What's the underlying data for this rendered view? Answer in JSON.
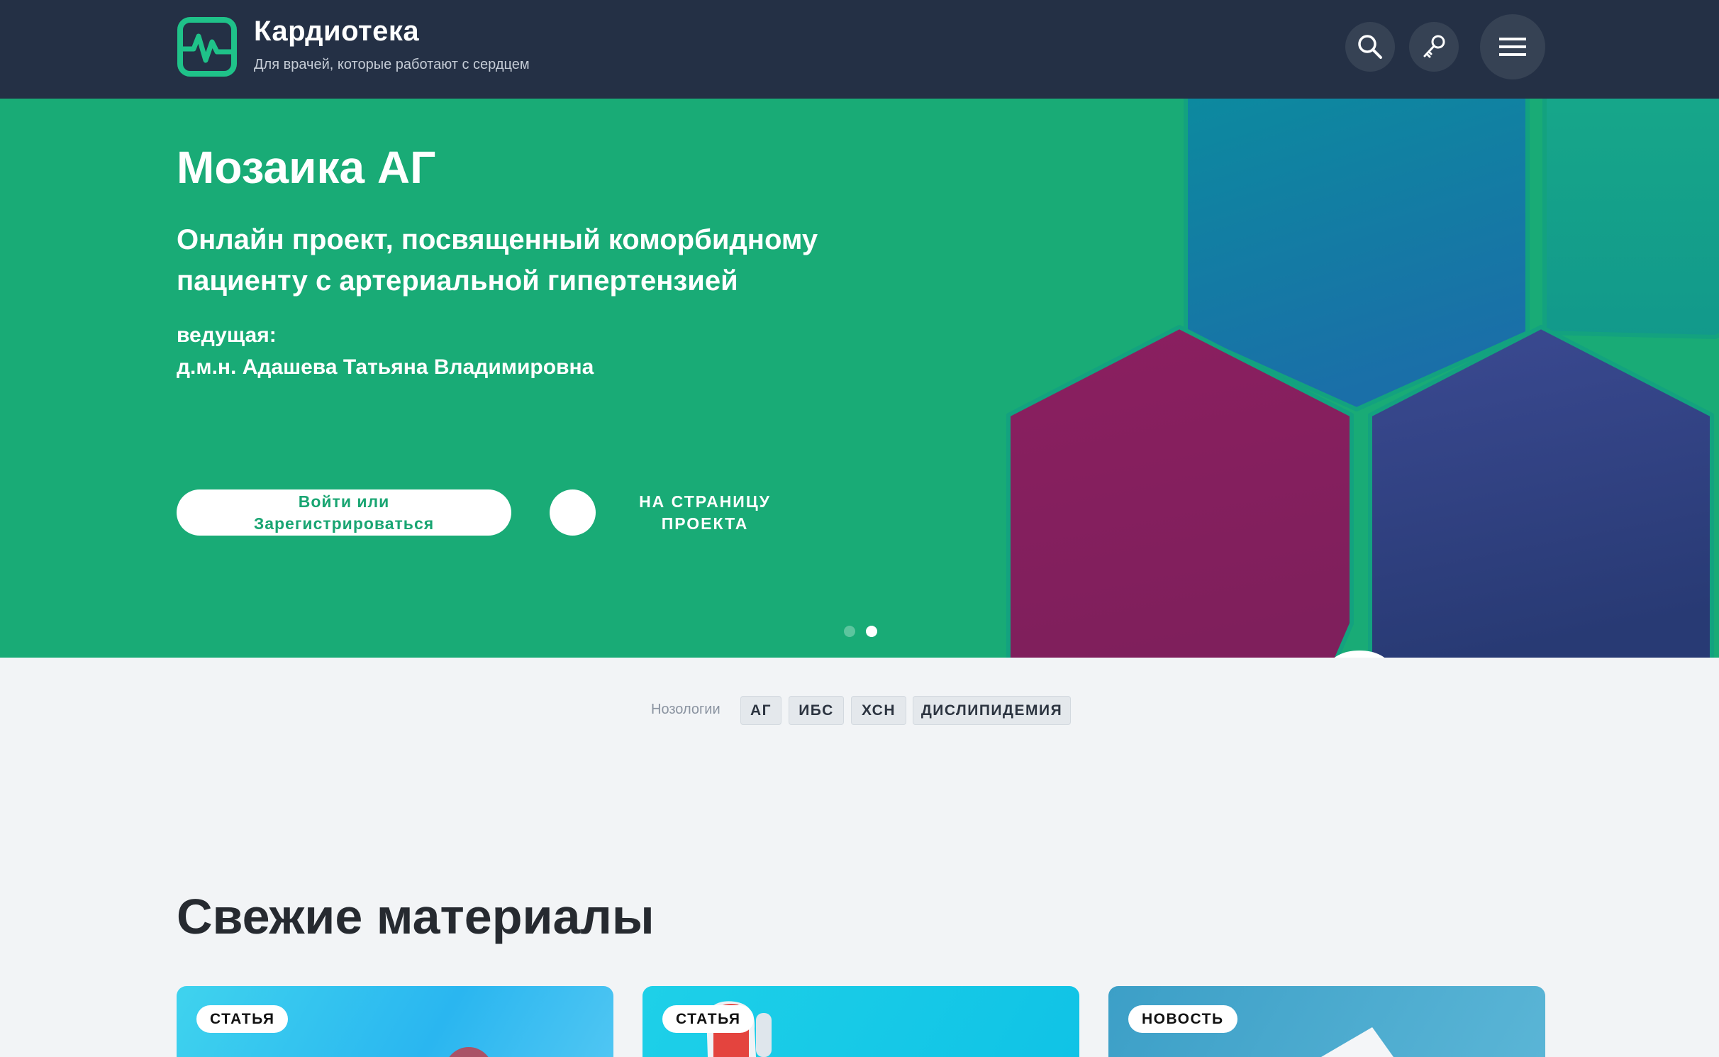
{
  "header": {
    "brand_name": "Кардиотека",
    "tagline": "Для врачей, которые работают с сердцем",
    "icons": [
      "search-icon",
      "key-icon",
      "menu-icon"
    ]
  },
  "hero": {
    "title": "Мозаика АГ",
    "subtitle": "Онлайн проект, посвященный коморбидному пациенту с артериальной гипертензией",
    "host_label": "ведущая:",
    "host_name": "д.м.н. Адашева Татьяна Владимировна",
    "login_button": "Войти или Зарегистрироваться",
    "project_link": "НА СТРАНИЦУ ПРОЕКТА",
    "slides_total": 2,
    "active_slide": 2
  },
  "nosology": {
    "label": "Нозологии",
    "tags": [
      "АГ",
      "ИБС",
      "ХСН",
      "ДИСЛИПИДЕМИЯ"
    ]
  },
  "materials": {
    "title": "Свежие материалы",
    "cards": [
      {
        "badge": "СТАТЬЯ"
      },
      {
        "badge": "СТАТЬЯ"
      },
      {
        "badge": "НОВОСТЬ"
      }
    ]
  },
  "colors": {
    "header_bg": "#243045",
    "hero_bg": "#19ab76",
    "accent": "#19a572",
    "page_bg": "#f2f4f6"
  }
}
